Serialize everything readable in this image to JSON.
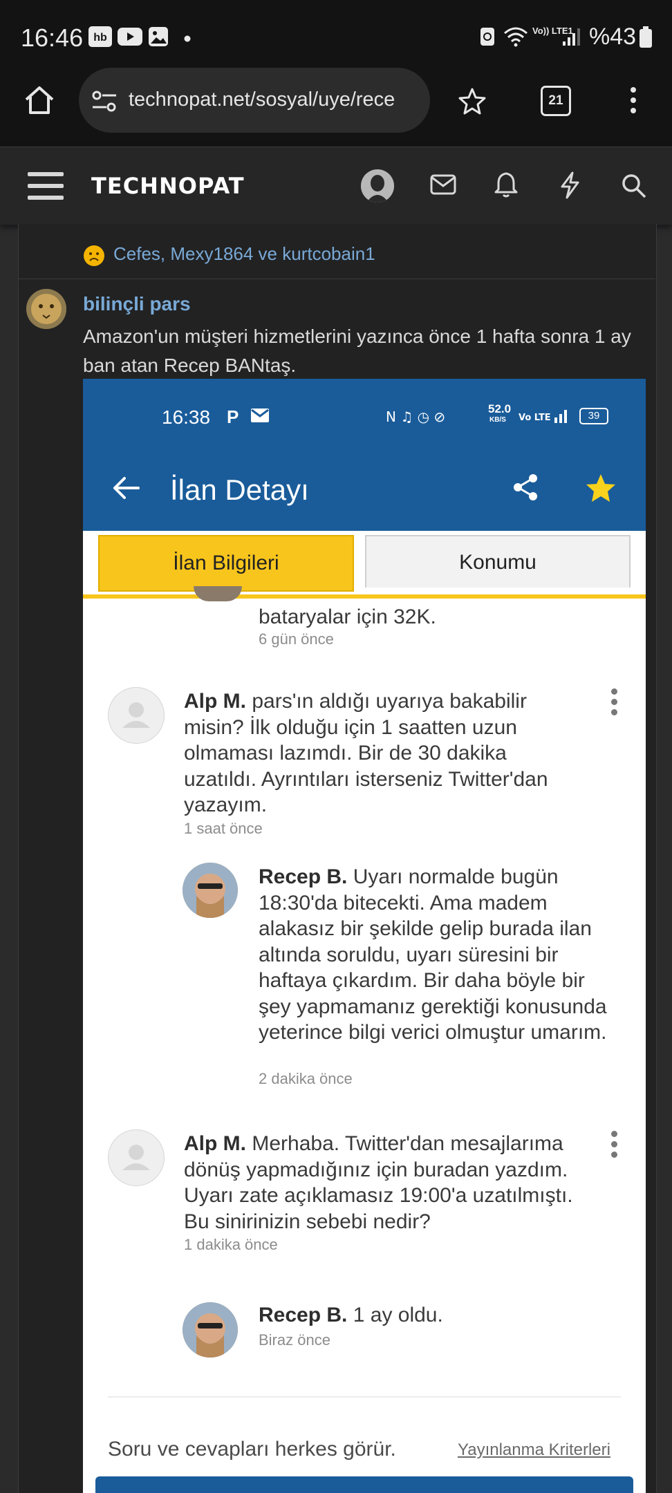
{
  "status_bar": {
    "time": "16:46",
    "network": "Vo)) LTE1",
    "battery": "%43"
  },
  "browser": {
    "url": "technopat.net/sosyal/uye/rece",
    "tab_count": "21"
  },
  "site": {
    "logo": "TECHNOPAT"
  },
  "post": {
    "reactions": "Cefes, Mexy1864 ve kurtcobain1",
    "author": "bilinçli pars",
    "text": "Amazon'un müşteri hizmetlerini yazınca önce 1 hafta sonra 1 ay ban atan Recep BANtaş."
  },
  "screenshot": {
    "status_time": "16:38",
    "status_letter": "P",
    "status_speed": "52.0",
    "status_speed_unit": "KB/S",
    "status_battery": "39",
    "title": "İlan Detayı",
    "tabs": [
      "İlan Bilgileri",
      "Konumu"
    ],
    "comments": [
      {
        "type": "partial",
        "text": "bataryalar için 32K.",
        "time": "6 gün önce"
      },
      {
        "type": "question",
        "name": "Alp M.",
        "text": "pars'ın aldığı uyarıya bakabilir misin? İlk olduğu için 1 saatten uzun olmaması lazımdı. Bir de 30 dakika uzatıldı. Ayrıntıları isterseniz Twitter'dan yazayım.",
        "time": "1 saat önce"
      },
      {
        "type": "answer",
        "name": "Recep B.",
        "text": "Uyarı normalde bugün 18:30'da bitecekti. Ama madem alakasız bir şekilde gelip burada ilan altında soruldu, uyarı süresini bir haftaya çıkardım. Bir daha böyle bir şey yapmamanız gerektiği konusunda yeterince bilgi verici olmuştur umarım.",
        "time": "2 dakika önce"
      },
      {
        "type": "question",
        "name": "Alp M.",
        "text": "Merhaba. Twitter'dan mesajlarıma dönüş yapmadığınız için buradan yazdım. Uyarı zate açıklamasız 19:00'a uzatılmıştı. Bu sinirinizin sebebi nedir?",
        "time": "1 dakika önce"
      },
      {
        "type": "answer",
        "name": "Recep B.",
        "text": "1 ay oldu.",
        "time": "Biraz önce"
      }
    ],
    "footer_text": "Soru ve cevapları herkes görür.",
    "footer_link": "Yayınlanma Kriterleri"
  }
}
